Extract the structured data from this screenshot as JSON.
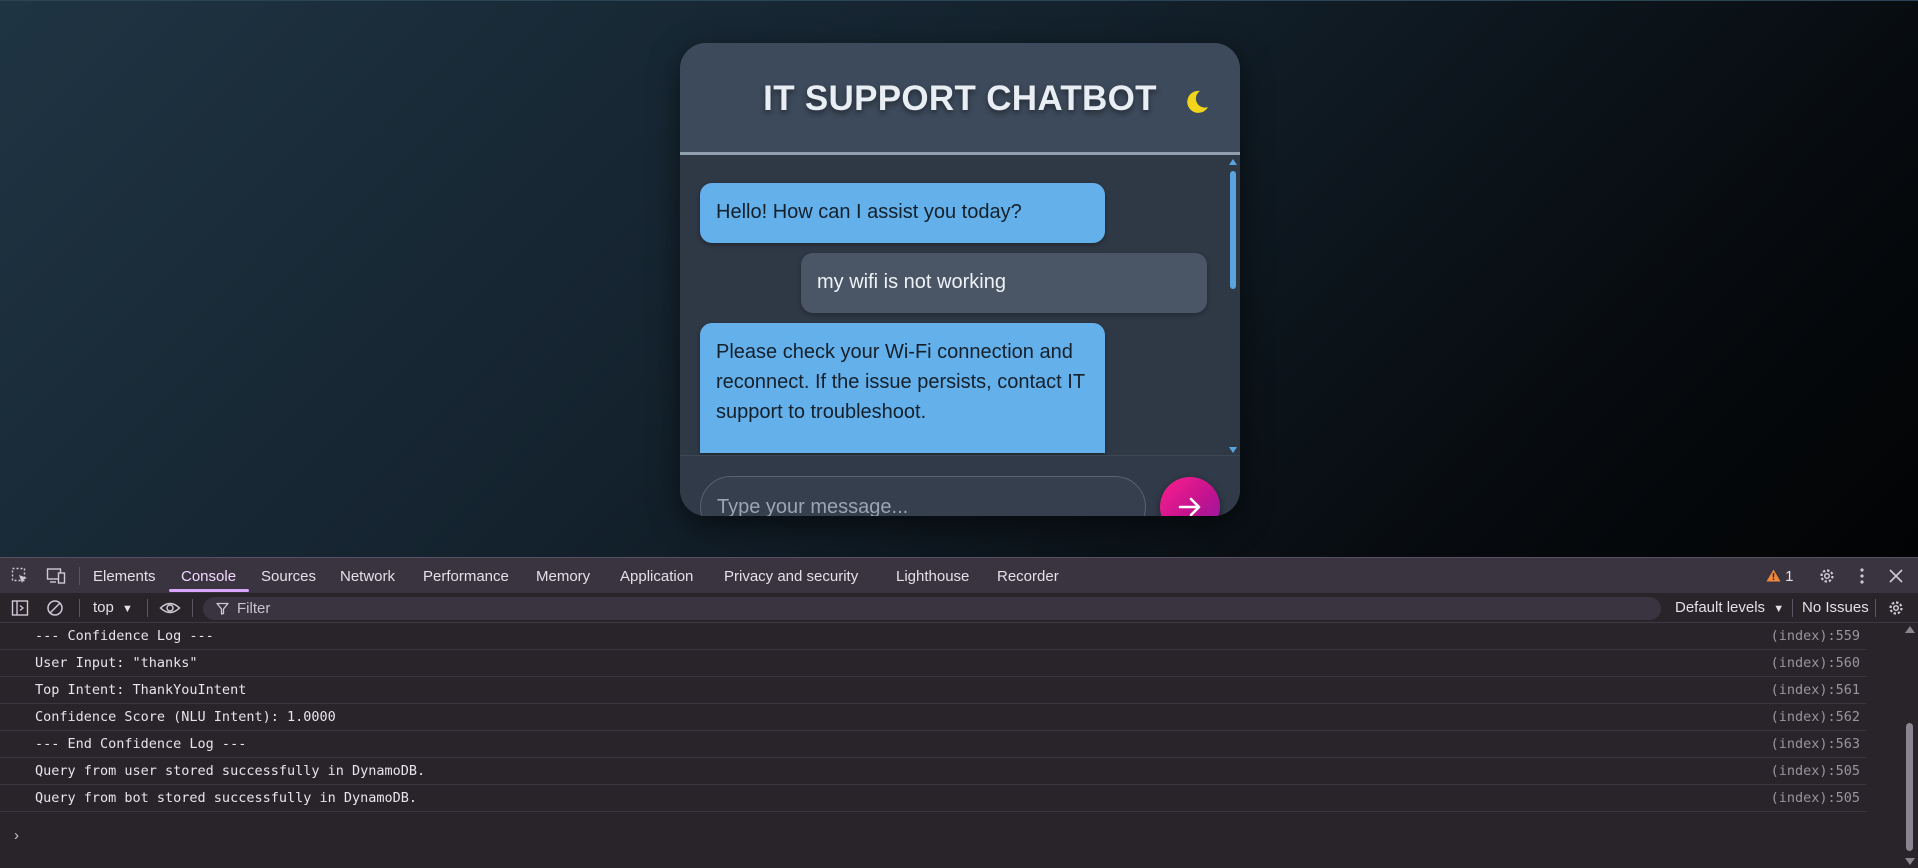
{
  "chat": {
    "title": "IT SUPPORT CHATBOT",
    "theme_icon": "moon-icon",
    "messages": [
      {
        "sender": "bot",
        "text": "Hello! How can I assist you today?"
      },
      {
        "sender": "user",
        "text": "my wifi is not working"
      },
      {
        "sender": "bot",
        "text": "Please check your Wi-Fi connection and reconnect. If the issue persists, contact IT support to troubleshoot."
      }
    ],
    "input_placeholder": "Type your message...",
    "send_icon": "arrow-right-icon"
  },
  "devtools": {
    "tabs": [
      "Elements",
      "Console",
      "Sources",
      "Network",
      "Performance",
      "Memory",
      "Application",
      "Privacy and security",
      "Lighthouse",
      "Recorder"
    ],
    "active_tab": "Console",
    "warning_count": "1",
    "context": "top",
    "filter_placeholder": "Filter",
    "levels": "Default levels",
    "issues": "No Issues",
    "logs": [
      {
        "text": "--- Confidence Log ---",
        "source": "(index):559"
      },
      {
        "text": "User Input: \"thanks\"",
        "source": "(index):560"
      },
      {
        "text": "Top Intent: ThankYouIntent",
        "source": "(index):561"
      },
      {
        "text": "Confidence Score (NLU Intent): 1.0000",
        "source": "(index):562"
      },
      {
        "text": "--- End Confidence Log ---",
        "source": "(index):563"
      },
      {
        "text": "Query from user stored successfully in DynamoDB.",
        "source": "(index):505"
      },
      {
        "text": "Query from bot stored successfully in DynamoDB.",
        "source": "(index):505"
      }
    ],
    "prompt": "›"
  },
  "colors": {
    "bot_bubble": "#63b0ea",
    "user_bubble": "#4a5666",
    "send_gradient_start": "#ff1f8c",
    "send_gradient_end": "#8a1aa8",
    "moon": "#f2d51a",
    "devtools_accent": "#d9a6ff"
  }
}
